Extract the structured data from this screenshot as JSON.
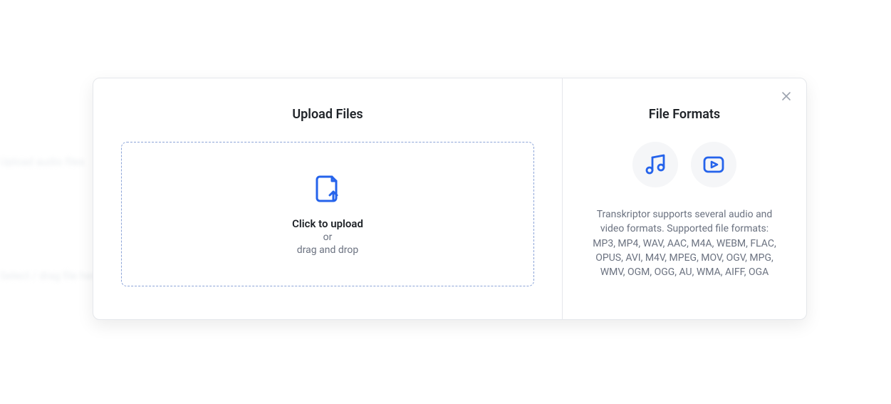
{
  "upload": {
    "title": "Upload Files",
    "line1": "Click to upload",
    "line2": "or",
    "line3": "drag and drop"
  },
  "formats": {
    "title": "File Formats",
    "description": "Transkriptor supports several audio and video formats. Supported file formats: MP3, MP4, WAV, AAC, M4A, WEBM, FLAC, OPUS, AVI, M4V, MPEG, MOV, OGV, MPG, WMV, OGM, OGG, AU, WMA, AIFF, OGA"
  },
  "colors": {
    "accent": "#2563eb"
  },
  "background_fragments": [
    "Upload files",
    "Upload audio files",
    "Select / drag file here"
  ]
}
